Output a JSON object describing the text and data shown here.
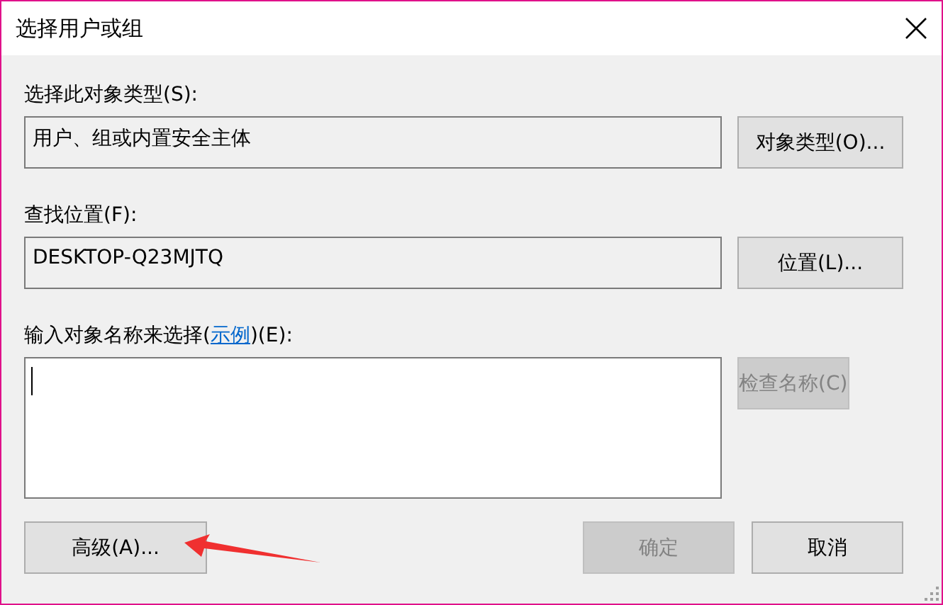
{
  "window": {
    "title": "选择用户或组"
  },
  "object_type": {
    "label": "选择此对象类型(S):",
    "value": "用户、组或内置安全主体",
    "button": {
      "label": "对象类型(O)...",
      "disabled": false
    }
  },
  "location": {
    "label": "查找位置(F):",
    "value": "DESKTOP-Q23MJTQ",
    "button": {
      "label": "位置(L)...",
      "disabled": false
    }
  },
  "names": {
    "label_before": "输入对象名称来选择(",
    "link": "示例",
    "label_after": ")(E):",
    "focused": true,
    "button": {
      "label": "检查名称(C)",
      "disabled": true
    }
  },
  "buttons": [
    {
      "label": "高级(A)...",
      "disabled": false
    },
    {
      "label": "确定",
      "disabled": true
    },
    {
      "label": "取消",
      "disabled": false
    }
  ]
}
